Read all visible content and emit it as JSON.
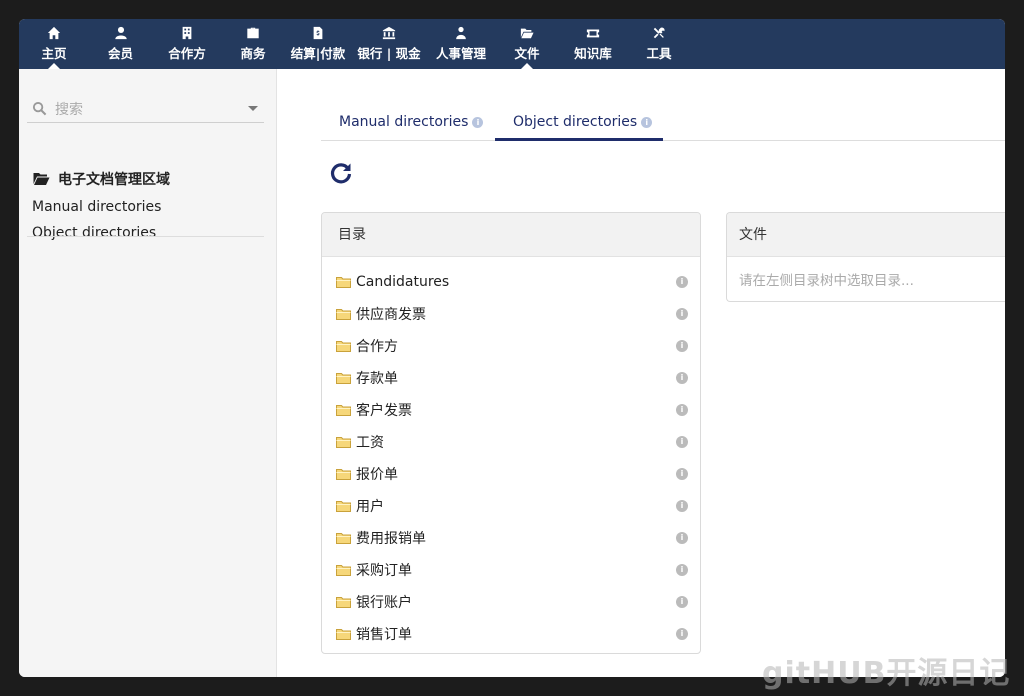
{
  "nav": {
    "items": [
      {
        "label": "主页",
        "icon": "home-icon",
        "active": true
      },
      {
        "label": "会员",
        "icon": "user-icon"
      },
      {
        "label": "合作方",
        "icon": "building-icon"
      },
      {
        "label": "商务",
        "icon": "briefcase-icon"
      },
      {
        "label": "结算|付款",
        "icon": "file-invoice-icon"
      },
      {
        "label": "银行 | 现金",
        "icon": "bank-icon"
      },
      {
        "label": "人事管理",
        "icon": "users-icon"
      },
      {
        "label": "文件",
        "icon": "folder-open-icon"
      },
      {
        "label": "知识库",
        "icon": "ticket-icon"
      },
      {
        "label": "工具",
        "icon": "tools-icon"
      }
    ]
  },
  "sidebar": {
    "search_placeholder": "搜索",
    "section_title": "电子文档管理区域",
    "links": [
      "Manual directories",
      "Object directories"
    ]
  },
  "tabs": {
    "manual": "Manual directories",
    "object": "Object directories",
    "active": "object"
  },
  "directory_panel": {
    "title": "目录",
    "items": [
      "Candidatures",
      "供应商发票",
      "合作方",
      "存款单",
      "客户发票",
      "工资",
      "报价单",
      "用户",
      "费用报销单",
      "采购订单",
      "银行账户",
      "销售订单"
    ]
  },
  "file_panel": {
    "title": "文件",
    "hint": "请在左侧目录树中选取目录..."
  },
  "watermark": "gitHUB开源日记",
  "colors": {
    "nav_bg": "#243a5e",
    "accent": "#1f2d6b"
  }
}
